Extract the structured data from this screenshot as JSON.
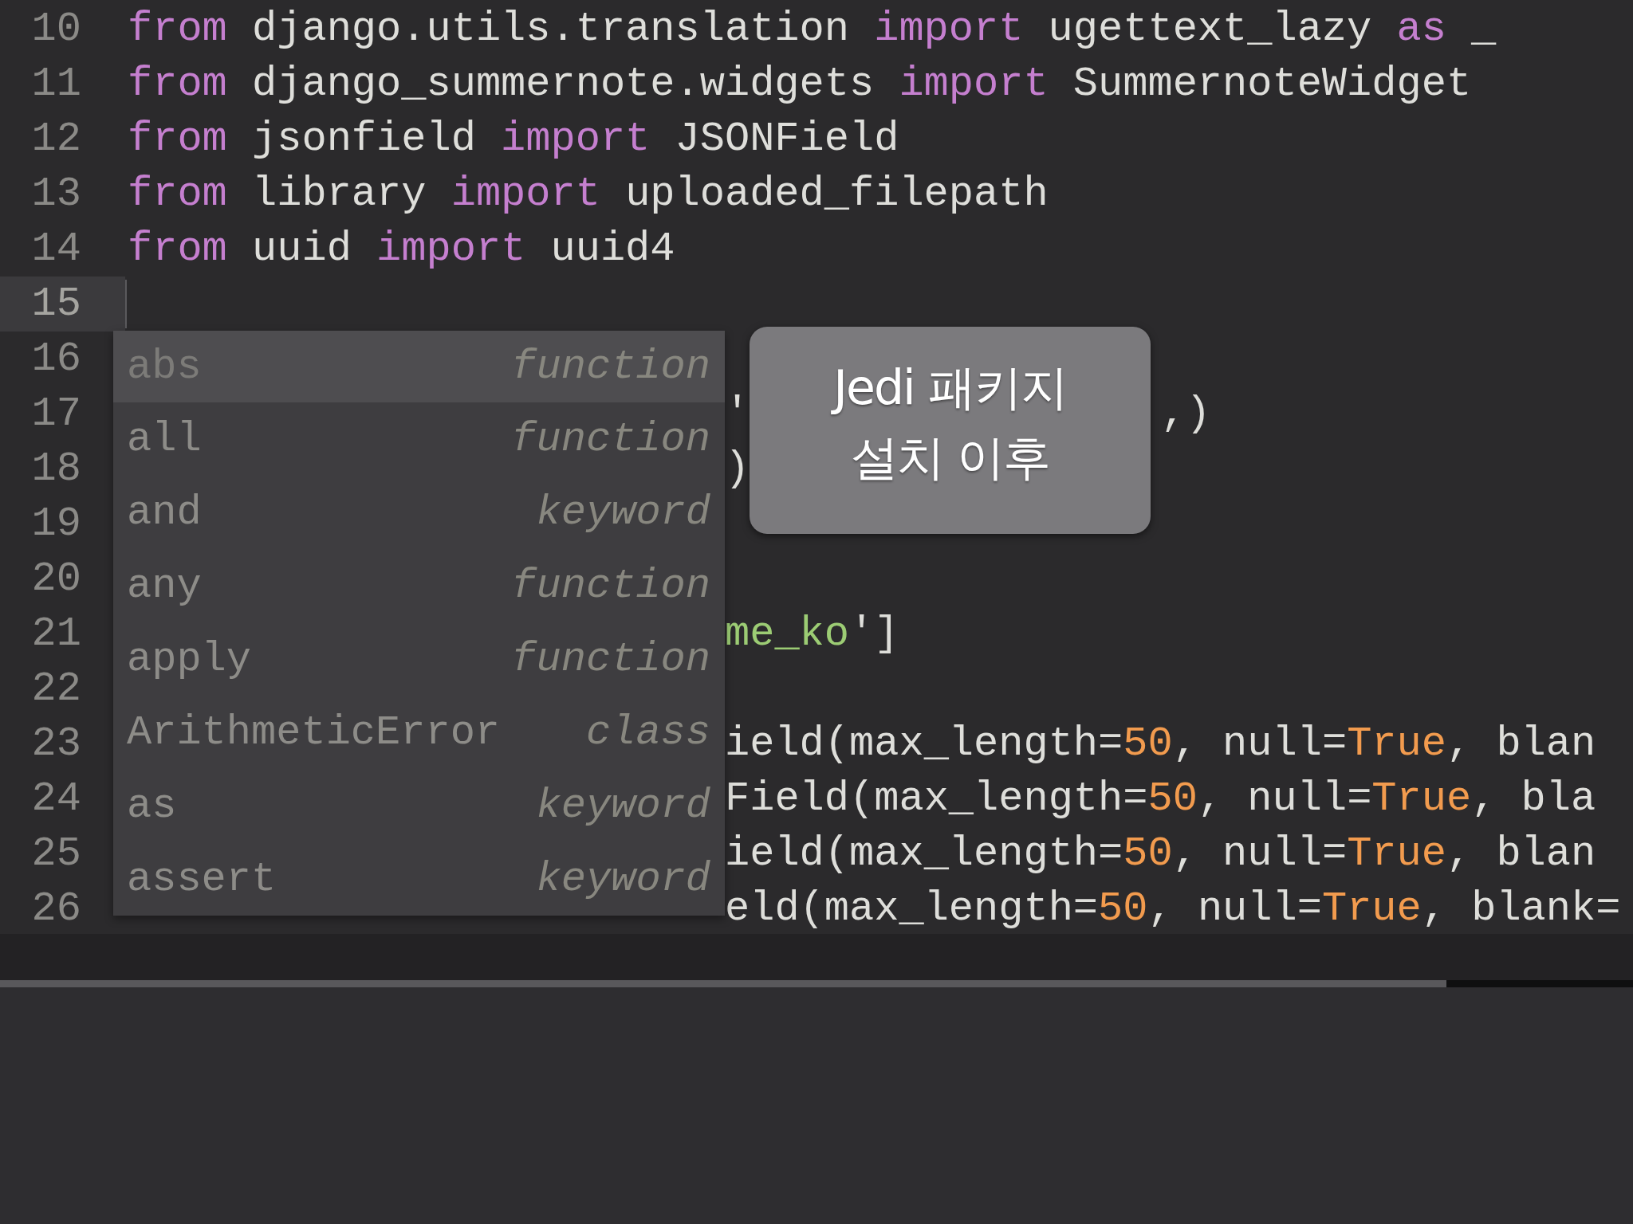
{
  "editor": {
    "lines": [
      {
        "number": "10",
        "current": false,
        "segments": [
          {
            "kind": "line",
            "tokens": [
              {
                "kind": "keyword",
                "text": "from"
              },
              {
                "kind": "plain",
                "text": " django.utils.translation "
              },
              {
                "kind": "keyword",
                "text": "import"
              },
              {
                "kind": "plain",
                "text": " ugettext_lazy "
              },
              {
                "kind": "keyword",
                "text": "as"
              },
              {
                "kind": "plain",
                "text": " _"
              }
            ]
          }
        ]
      },
      {
        "number": "11",
        "current": false,
        "segments": [
          {
            "kind": "line",
            "tokens": [
              {
                "kind": "keyword",
                "text": "from"
              },
              {
                "kind": "plain",
                "text": " django_summernote.widgets "
              },
              {
                "kind": "keyword",
                "text": "import"
              },
              {
                "kind": "plain",
                "text": " SummernoteWidget"
              }
            ]
          }
        ]
      },
      {
        "number": "12",
        "current": false,
        "segments": [
          {
            "kind": "line",
            "tokens": [
              {
                "kind": "keyword",
                "text": "from"
              },
              {
                "kind": "plain",
                "text": " jsonfield "
              },
              {
                "kind": "keyword",
                "text": "import"
              },
              {
                "kind": "plain",
                "text": " JSONField"
              }
            ]
          }
        ]
      },
      {
        "number": "13",
        "current": false,
        "segments": [
          {
            "kind": "line",
            "tokens": [
              {
                "kind": "keyword",
                "text": "from"
              },
              {
                "kind": "plain",
                "text": " library "
              },
              {
                "kind": "keyword",
                "text": "import"
              },
              {
                "kind": "plain",
                "text": " uploaded_filepath"
              }
            ]
          }
        ]
      },
      {
        "number": "14",
        "current": false,
        "segments": [
          {
            "kind": "line",
            "tokens": [
              {
                "kind": "keyword",
                "text": "from"
              },
              {
                "kind": "plain",
                "text": " uuid "
              },
              {
                "kind": "keyword",
                "text": "import"
              },
              {
                "kind": "plain",
                "text": " uuid4"
              }
            ]
          }
        ]
      },
      {
        "number": "15",
        "current": true
      },
      {
        "number": "16",
        "current": false
      },
      {
        "number": "17",
        "current": false,
        "segments": [
          {
            "kind": "after-popup",
            "tokens": [
              {
                "kind": "plain",
                "text": "'"
              }
            ]
          },
          {
            "kind": "after-tooltip",
            "tokens": [
              {
                "kind": "plain",
                "text": ",)"
              }
            ]
          }
        ]
      },
      {
        "number": "18",
        "current": false,
        "segments": [
          {
            "kind": "after-popup",
            "tokens": [
              {
                "kind": "plain",
                "text": ")"
              }
            ]
          }
        ]
      },
      {
        "number": "19",
        "current": false
      },
      {
        "number": "20",
        "current": false
      },
      {
        "number": "21",
        "current": false,
        "segments": [
          {
            "kind": "after-popup",
            "tokens": [
              {
                "kind": "string",
                "text": "me_ko"
              },
              {
                "kind": "plain",
                "text": "']"
              }
            ]
          }
        ]
      },
      {
        "number": "22",
        "current": false
      },
      {
        "number": "23",
        "current": false,
        "segments": [
          {
            "kind": "after-popup",
            "tokens": [
              {
                "kind": "plain",
                "text": "ield(max_length="
              },
              {
                "kind": "number",
                "text": "50"
              },
              {
                "kind": "plain",
                "text": ", null="
              },
              {
                "kind": "number",
                "text": "True"
              },
              {
                "kind": "plain",
                "text": ", blan"
              }
            ]
          }
        ]
      },
      {
        "number": "24",
        "current": false,
        "segments": [
          {
            "kind": "after-popup",
            "tokens": [
              {
                "kind": "plain",
                "text": "Field(max_length="
              },
              {
                "kind": "number",
                "text": "50"
              },
              {
                "kind": "plain",
                "text": ", null="
              },
              {
                "kind": "number",
                "text": "True"
              },
              {
                "kind": "plain",
                "text": ", bla"
              }
            ]
          }
        ]
      },
      {
        "number": "25",
        "current": false,
        "segments": [
          {
            "kind": "after-popup",
            "tokens": [
              {
                "kind": "plain",
                "text": "ield(max_length="
              },
              {
                "kind": "number",
                "text": "50"
              },
              {
                "kind": "plain",
                "text": ", null="
              },
              {
                "kind": "number",
                "text": "True"
              },
              {
                "kind": "plain",
                "text": ", blan"
              }
            ]
          }
        ]
      },
      {
        "number": "26",
        "current": false,
        "segments": [
          {
            "kind": "after-popup",
            "tokens": [
              {
                "kind": "plain",
                "text": "eld(max_length="
              },
              {
                "kind": "number",
                "text": "50"
              },
              {
                "kind": "plain",
                "text": ", null="
              },
              {
                "kind": "number",
                "text": "True"
              },
              {
                "kind": "plain",
                "text": ", blank="
              }
            ]
          }
        ]
      }
    ]
  },
  "autocomplete": {
    "items": [
      {
        "label": "abs",
        "type": "function",
        "selected": true
      },
      {
        "label": "all",
        "type": "function",
        "selected": false
      },
      {
        "label": "and",
        "type": "keyword",
        "selected": false
      },
      {
        "label": "any",
        "type": "function",
        "selected": false
      },
      {
        "label": "apply",
        "type": "function",
        "selected": false
      },
      {
        "label": "ArithmeticError",
        "type": "class",
        "selected": false
      },
      {
        "label": "as",
        "type": "keyword",
        "selected": false
      },
      {
        "label": "assert",
        "type": "keyword",
        "selected": false
      }
    ]
  },
  "caption": {
    "lines": [
      "Jedi 패키지",
      "설치 이후"
    ]
  }
}
